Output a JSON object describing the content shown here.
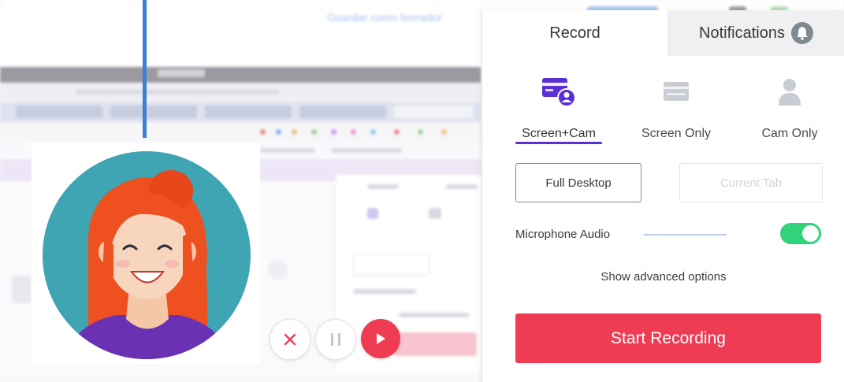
{
  "background": {
    "ghost_link_text": "Guardar como borrador"
  },
  "popup": {
    "tabs": {
      "record": "Record",
      "notifications": "Notifications"
    },
    "modes": [
      {
        "label": "Screen+Cam",
        "icon": "screen-cam-icon",
        "active": true
      },
      {
        "label": "Screen Only",
        "icon": "screen-icon",
        "active": false
      },
      {
        "label": "Cam Only",
        "icon": "person-icon",
        "active": false
      }
    ],
    "capture": {
      "full_desktop": "Full Desktop",
      "current_tab": "Current Tab"
    },
    "microphone": {
      "label": "Microphone Audio",
      "enabled": true
    },
    "advanced_link": "Show advanced options",
    "start_button": "Start Recording"
  },
  "colors": {
    "accent_purple": "#5b2fd6",
    "record_red": "#ef3c55",
    "toggle_green": "#2ed37a",
    "pointer_blue": "#3d7fd0",
    "avatar_teal": "#3fa5b3"
  }
}
